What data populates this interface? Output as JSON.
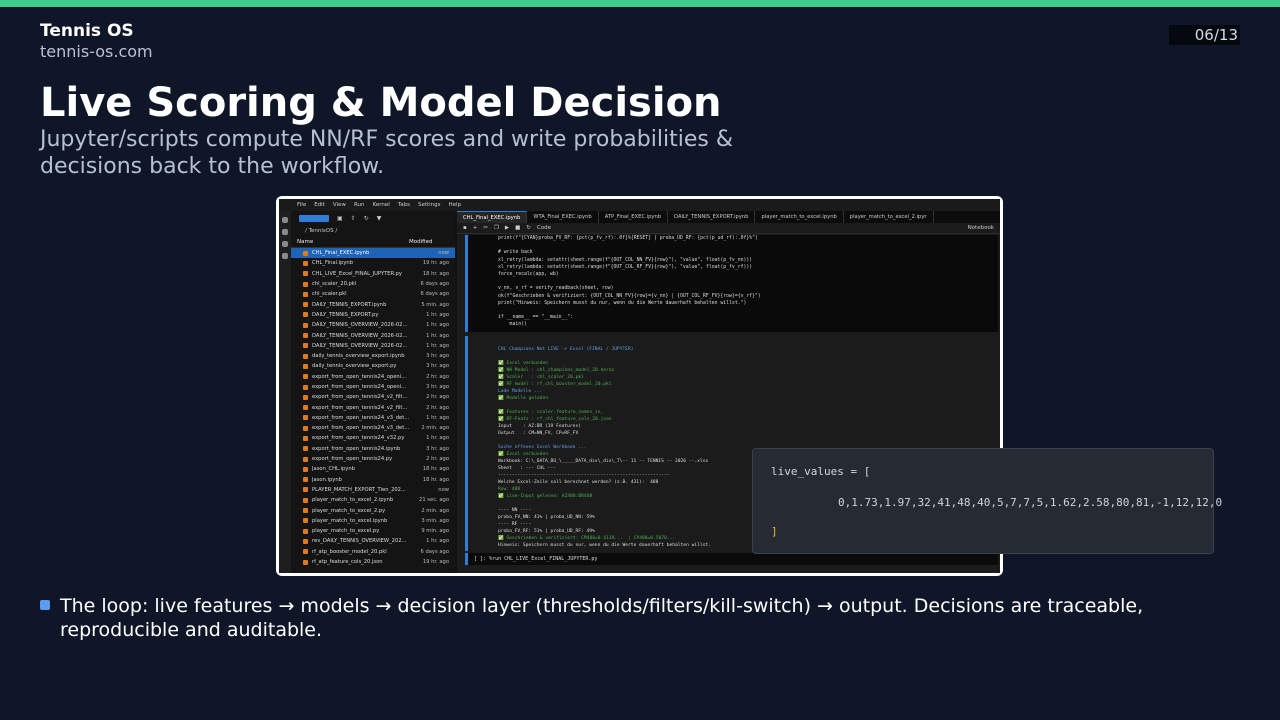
{
  "header": {
    "brand": "Tennis OS",
    "url": "tennis-os.com",
    "page": "06/13"
  },
  "title": "Live Scoring & Model Decision",
  "subtitle": "Jupyter/scripts compute NN/RF scores and write probabilities & decisions back to the workflow.",
  "jupyter": {
    "menu": [
      "File",
      "Edit",
      "View",
      "Run",
      "Kernel",
      "Tabs",
      "Settings",
      "Help"
    ],
    "breadcrumb": "/ TennisOS /",
    "columns": {
      "name": "Name",
      "modified": "Modified"
    },
    "files": [
      {
        "name": "CHL_Final_EXEC.ipynb",
        "modified": "now"
      },
      {
        "name": "CHL_Final.ipynb",
        "modified": "19 hr. ago"
      },
      {
        "name": "CHL_LIVE_Excel_FINAL_JUPYTER.py",
        "modified": "18 hr. ago"
      },
      {
        "name": "chl_scaler_20.pkl",
        "modified": "6 days ago"
      },
      {
        "name": "chl_scaler.pkl",
        "modified": "6 days ago"
      },
      {
        "name": "DAILY_TENNIS_EXPORT.ipynb",
        "modified": "5 min. ago"
      },
      {
        "name": "DAILY_TENNIS_EXPORT.py",
        "modified": "1 hr. ago"
      },
      {
        "name": "DAILY_TENNIS_OVERVIEW_2026-02...",
        "modified": "1 hr. ago"
      },
      {
        "name": "DAILY_TENNIS_OVERVIEW_2026-02...",
        "modified": "1 hr. ago"
      },
      {
        "name": "DAILY_TENNIS_OVERVIEW_2026-02...",
        "modified": "1 hr. ago"
      },
      {
        "name": "daily_tennis_overview_export.ipynb",
        "modified": "3 hr. ago"
      },
      {
        "name": "daily_tennis_overview_export.py",
        "modified": "3 hr. ago"
      },
      {
        "name": "export_from_open_tennis24_openi...",
        "modified": "2 hr. ago"
      },
      {
        "name": "export_from_open_tennis24_openi...",
        "modified": "3 hr. ago"
      },
      {
        "name": "export_from_open_tennis24_v2_filt...",
        "modified": "2 hr. ago"
      },
      {
        "name": "export_from_open_tennis24_v2_filt...",
        "modified": "2 hr. ago"
      },
      {
        "name": "export_from_open_tennis24_v3_det...",
        "modified": "1 hr. ago"
      },
      {
        "name": "export_from_open_tennis24_v3_det...",
        "modified": "2 min. ago"
      },
      {
        "name": "export_from_open_tennis24_v32.py",
        "modified": "1 hr. ago"
      },
      {
        "name": "export_from_open_tennis24.ipynb",
        "modified": "3 hr. ago"
      },
      {
        "name": "export_from_open_tennis24.py",
        "modified": "2 hr. ago"
      },
      {
        "name": "Jason_CHL.ipynb",
        "modified": "18 hr. ago"
      },
      {
        "name": "Jason.ipynb",
        "modified": "18 hr. ago"
      },
      {
        "name": "PLAYER_MATCH_EXPORT_Tien_202...",
        "modified": "now"
      },
      {
        "name": "player_match_to_excel_2.ipynb",
        "modified": "21 sec. ago"
      },
      {
        "name": "player_match_to_excel_2.py",
        "modified": "2 min. ago"
      },
      {
        "name": "player_match_to_excel.ipynb",
        "modified": "3 min. ago"
      },
      {
        "name": "player_match_to_excel.py",
        "modified": "9 min. ago"
      },
      {
        "name": "rev_DAILY_TENNIS_OVERVIEW_202...",
        "modified": "1 hr. ago"
      },
      {
        "name": "rf_atp_booster_model_20.pkl",
        "modified": "6 days ago"
      },
      {
        "name": "rf_atp_feature_cols_20.json",
        "modified": "19 hr. ago"
      }
    ],
    "tabs": [
      "CHL_Final_EXEC.ipynb",
      "WTA_Final_EXEC.ipynb",
      "ATP_Final_EXEC.ipynb",
      "DAILY_TENNIS_EXPORT.ipynb",
      "player_match_to_excel.ipynb",
      "player_match_to_excel_2.ipyr"
    ],
    "toolbar": {
      "celltype": "Code",
      "kernel": "Notebook"
    },
    "code": "print(f\"{CYAN}proba_FV_RF: {pct(p_fv_rf):.0f}%{RESET} | proba_UD_RF: {pct(p_ud_rf):.0f}%\")\n\n# write back\nxl_retry(lambda: setattr(sheet.range(f\"{OUT_COL_NN_FV}{row}\"), \"value\", float(p_fv_nn)))\nxl_retry(lambda: setattr(sheet.range(f\"{OUT_COL_RF_FV}{row}\"), \"value\", float(p_fv_rf)))\nforce_recalc(app, wb)\n\nv_nn, v_rf = verify_readback(sheet, row)\nok(f\"Geschrieben & verifiziert: {OUT_COL_NN_FV}{row}={v_nn} | {OUT_COL_RF_FV}{row}={v_rf}\")\nprint(\"Hinweis: Speichern musst du nur, wenn du die Werte dauerhaft behalten willst.\")\n\nif __name__ == \"__main__\":\n    main()",
    "output": [
      {
        "t": "CHL Champions Net LIVE -> Excel (FINAL / JUPYTER)",
        "c": "b"
      },
      {
        "t": "",
        "c": ""
      },
      {
        "t": "✅ Excel verbunden",
        "c": "g"
      },
      {
        "t": "✅ NN Model : chl_champions_model_20.keras",
        "c": "g"
      },
      {
        "t": "✅ Scaler   : chl_scaler_20.pkl",
        "c": "g"
      },
      {
        "t": "✅ RF model : rf_chl_booster_model_20.pkl",
        "c": "g"
      },
      {
        "t": "Lade Modelle ...",
        "c": "b"
      },
      {
        "t": "✅ Modelle geladen",
        "c": "g"
      },
      {
        "t": "",
        "c": ""
      },
      {
        "t": "✅ Features : scaler.feature_names_in_",
        "c": "g"
      },
      {
        "t": "✅ RF-Feats : rf_chl_feature_cols_20.json",
        "c": "g"
      },
      {
        "t": "Input    : AZ:BR (19 Features)",
        "c": ""
      },
      {
        "t": "Output   : CM=NN_FV, CP=RF_FV",
        "c": ""
      },
      {
        "t": "",
        "c": ""
      },
      {
        "t": "Suche offenes Excel Workbook ...",
        "c": "b"
      },
      {
        "t": "✅ Excel verbunden",
        "c": "g"
      },
      {
        "t": "Workbook: C:\\_DATA_BU_\\_____DATA_div\\_div\\_T\\-- 11 -- TENNIS -- 2026 --.xlsx",
        "c": ""
      },
      {
        "t": "Sheet   : --- CHL ---",
        "c": ""
      },
      {
        "t": "--------------------------------------------------------------",
        "c": ""
      },
      {
        "t": "Welche Excel-Zeile soll berechnet werden? (z.B. 431):  488",
        "c": ""
      },
      {
        "t": "Row: 488",
        "c": "g"
      },
      {
        "t": "✅ Live-Input gelesen: AZ488:BR488",
        "c": "g"
      },
      {
        "t": "",
        "c": ""
      },
      {
        "t": "---- NN ----",
        "c": ""
      },
      {
        "t": "proba_FV_NN: 41% | proba_UD_NN: 59%",
        "c": ""
      },
      {
        "t": "---- RF ----",
        "c": ""
      },
      {
        "t": "proba_FV_RF: 51% | proba_UD_RF: 49%",
        "c": ""
      },
      {
        "t": "✅ Geschrieben & verifiziert: CM488=0.4119...  | CP488=0.5070...",
        "c": "g"
      },
      {
        "t": "Hinweis: Speichern musst du nur, wenn du die Werte dauerhaft behalten willst.",
        "c": ""
      }
    ],
    "cell2": "[ ]:  %run CHL_LIVE_Excel_FINAL_JUPYTER.py"
  },
  "live_values": {
    "head": "live_values = [",
    "values": "0,1.73,1.97,32,41,48,40,5,7,7,5,1.62,2.58,80,81,-1,12,12,0",
    "close": "]"
  },
  "bullet": "The loop: live features → models → decision layer (thresholds/filters/kill-switch) → output. Decisions are traceable, reproducible and auditable.",
  "colors": {
    "accent": "#3ecf8e",
    "background": "#0f1628",
    "bullet": "#5b9cf0",
    "jupyter_select": "#1d63b8"
  }
}
